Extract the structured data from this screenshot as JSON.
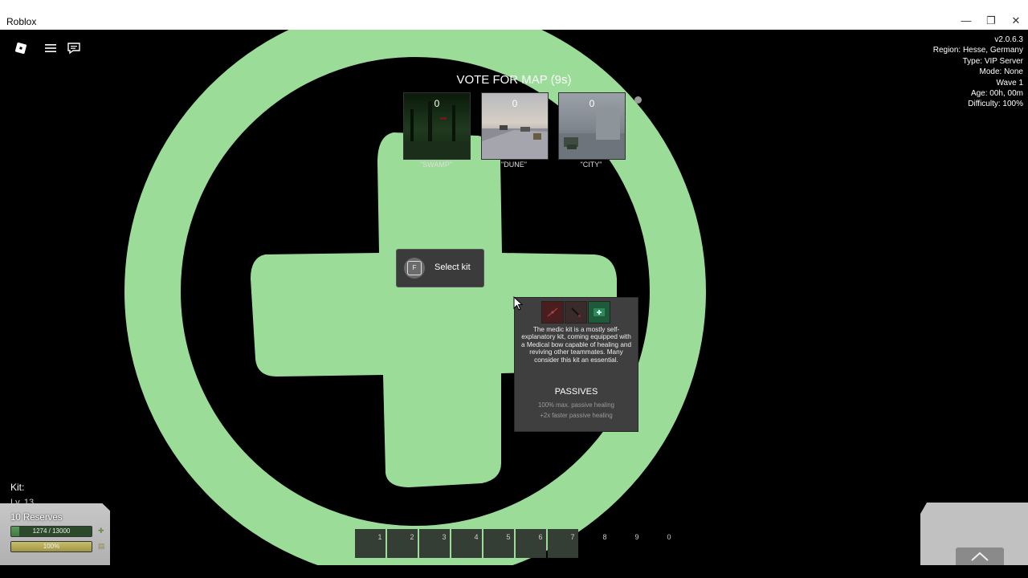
{
  "window": {
    "title": "Roblox",
    "minimize_glyph": "—",
    "restore_glyph": "❐",
    "close_glyph": "✕"
  },
  "server_info": {
    "version": "v2.0.6.3",
    "region": "Region: Hesse, Germany",
    "type": "Type: VIP Server",
    "mode": "Mode: None",
    "wave": "Wave 1",
    "age": "Age: 00h, 00m",
    "difficulty": "Difficulty: 100%"
  },
  "vote": {
    "title": "VOTE FOR MAP (9s)",
    "maps": [
      {
        "name": "\"SWAMP\"",
        "votes": "0"
      },
      {
        "name": "\"DUNE\"",
        "votes": "0"
      },
      {
        "name": "\"CITY\"",
        "votes": "0"
      }
    ]
  },
  "select_kit": {
    "key": "F",
    "label": "Select kit"
  },
  "kit_panel": {
    "description": "The medic kit is a mostly self-explanatory kit, coming equipped with a Medical bow capable of healing and reviving other teammates. Many consider this kit an essential.",
    "passives_title": "PASSIVES",
    "passives": [
      "100% max. passive healing",
      "+2x faster passive healing"
    ],
    "item_icons": [
      "bow-item-icon",
      "arrow-item-icon",
      "medkit-item-icon"
    ]
  },
  "player": {
    "kit_label": "Kit:",
    "level_label": "Lv. 13",
    "reserves_label": "10 Reserves",
    "health_text": "1274 / 13000",
    "health_fraction": 0.098,
    "stamina_text": "100%",
    "stamina_fraction": 1.0
  },
  "hotbar": {
    "slots": [
      "1",
      "2",
      "3",
      "4",
      "5",
      "6",
      "7",
      "8",
      "9",
      "0"
    ]
  },
  "colors": {
    "medic_green": "#9bdc99",
    "panel_bg": "#3f3f3f",
    "health_green": "#4f8a4f",
    "stamina_yellow": "#c9be6a"
  }
}
